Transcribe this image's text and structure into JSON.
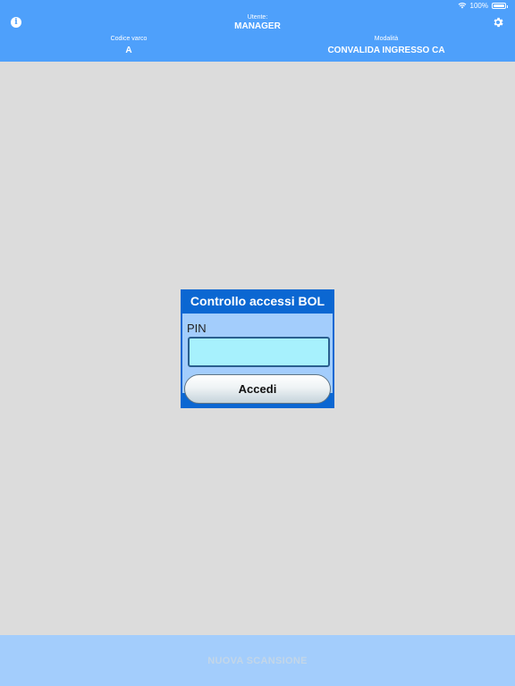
{
  "status_bar": {
    "battery": "100%",
    "icons": [
      "wifi-icon",
      "battery-icon"
    ]
  },
  "header": {
    "user_label": "Utente:",
    "user_value": "MANAGER",
    "gate_code_label": "Codice varco",
    "gate_code_value": "A",
    "mode_label": "Modalità",
    "mode_value": "CONVALIDA INGRESSO CA",
    "icons": [
      "info-icon",
      "gear-icon"
    ]
  },
  "dialog": {
    "title": "Controllo accessi BOL",
    "pin_label": "PIN",
    "pin_value": "",
    "login_button": "Accedi"
  },
  "footer": {
    "new_scan_button": "NUOVA SCANSIONE"
  },
  "colors": {
    "header": "#4ea0fb",
    "background": "#dcdcdc",
    "dialog_frame": "#0b67d2",
    "dialog_body": "#a3cdfc",
    "pin_field": "#a7f1fd",
    "footer": "#a3cdfc",
    "footer_text_disabled": "#c3d6e8"
  }
}
